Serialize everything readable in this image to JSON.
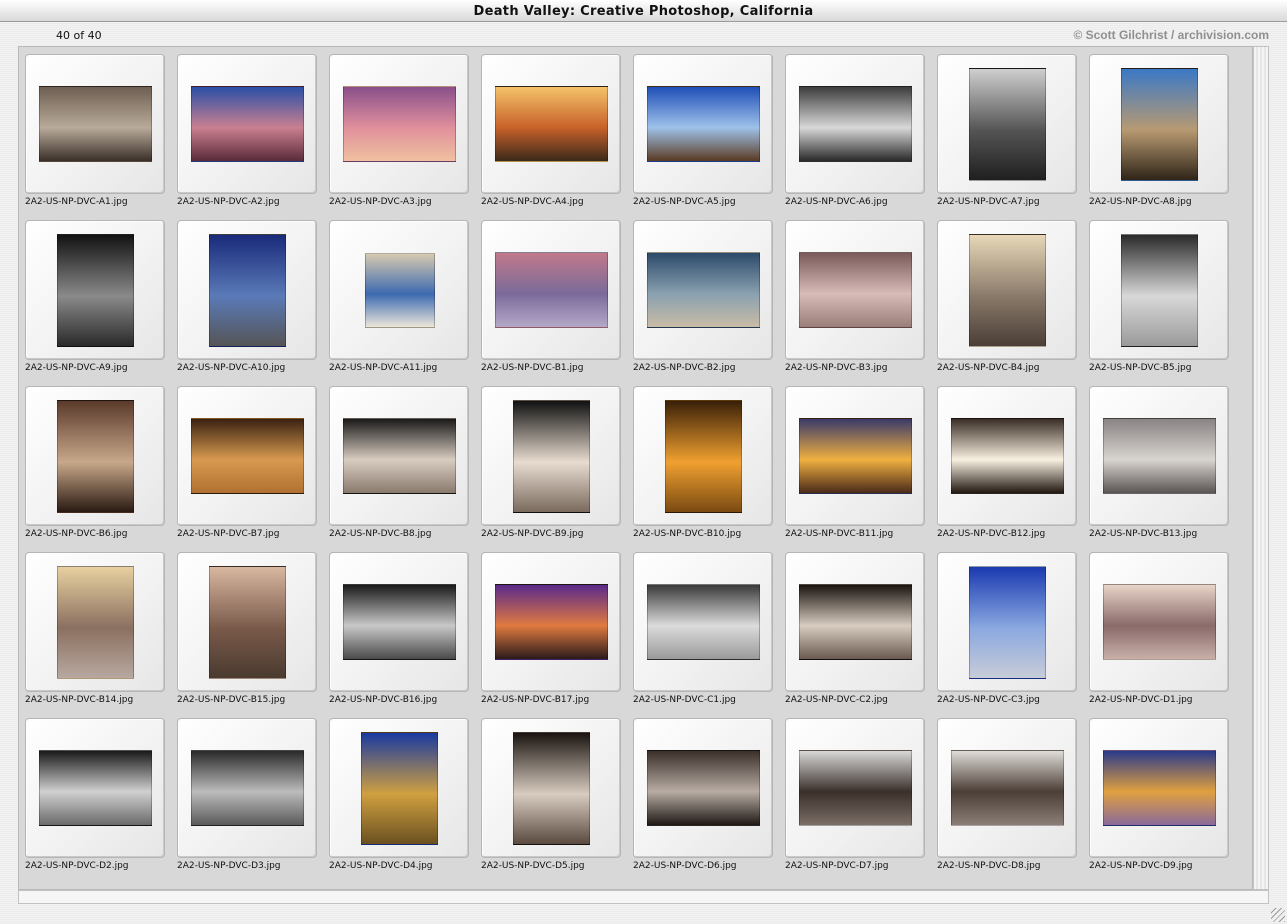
{
  "window": {
    "title": "Death Valley: Creative Photoshop, California"
  },
  "header": {
    "count": "40 of 40",
    "credit": "© Scott Gilchrist / archivision.com"
  },
  "thumbnails": [
    {
      "file": "2A2-US-NP-DVC-A1.jpg",
      "orientation": "landscape",
      "colors": [
        "#6e5f52",
        "#b8aa9a",
        "#3a3029"
      ]
    },
    {
      "file": "2A2-US-NP-DVC-A2.jpg",
      "orientation": "landscape",
      "colors": [
        "#2a4fa6",
        "#c98090",
        "#5a2a3a"
      ]
    },
    {
      "file": "2A2-US-NP-DVC-A3.jpg",
      "orientation": "landscape",
      "colors": [
        "#8a4f8a",
        "#e0909c",
        "#f0c0a0"
      ]
    },
    {
      "file": "2A2-US-NP-DVC-A4.jpg",
      "orientation": "landscape",
      "colors": [
        "#f4c26a",
        "#c8612a",
        "#3b2a1a"
      ]
    },
    {
      "file": "2A2-US-NP-DVC-A5.jpg",
      "orientation": "landscape",
      "colors": [
        "#1f4fb8",
        "#9fc2ea",
        "#5a3a22"
      ]
    },
    {
      "file": "2A2-US-NP-DVC-A6.jpg",
      "orientation": "landscape",
      "colors": [
        "#3d3d3d",
        "#d8d8d8",
        "#2a2a2a"
      ]
    },
    {
      "file": "2A2-US-NP-DVC-A7.jpg",
      "orientation": "portrait",
      "colors": [
        "#cfcfcf",
        "#555555",
        "#1f1f1f"
      ]
    },
    {
      "file": "2A2-US-NP-DVC-A8.jpg",
      "orientation": "portrait",
      "colors": [
        "#3b78c6",
        "#b89a72",
        "#2f2418"
      ]
    },
    {
      "file": "2A2-US-NP-DVC-A9.jpg",
      "orientation": "portrait",
      "colors": [
        "#121212",
        "#8a8a8a",
        "#2a2a2a"
      ]
    },
    {
      "file": "2A2-US-NP-DVC-A10.jpg",
      "orientation": "portrait",
      "colors": [
        "#1a2a7a",
        "#5a7ab8",
        "#555555"
      ]
    },
    {
      "file": "2A2-US-NP-DVC-A11.jpg",
      "orientation": "small",
      "colors": [
        "#d6c9b0",
        "#3c6ab0",
        "#ece6da"
      ]
    },
    {
      "file": "2A2-US-NP-DVC-B1.jpg",
      "orientation": "landscape",
      "colors": [
        "#c07a8a",
        "#7a6a9a",
        "#b4a8c8"
      ]
    },
    {
      "file": "2A2-US-NP-DVC-B2.jpg",
      "orientation": "landscape",
      "colors": [
        "#2c4a6a",
        "#8aa0b0",
        "#c8bca6"
      ]
    },
    {
      "file": "2A2-US-NP-DVC-B3.jpg",
      "orientation": "landscape",
      "colors": [
        "#7a5a5a",
        "#d8bcb8",
        "#9a7e7a"
      ]
    },
    {
      "file": "2A2-US-NP-DVC-B4.jpg",
      "orientation": "portrait",
      "colors": [
        "#e8d8b8",
        "#8a7a6a",
        "#4a3e36"
      ]
    },
    {
      "file": "2A2-US-NP-DVC-B5.jpg",
      "orientation": "portrait",
      "colors": [
        "#2a2a2a",
        "#d8d8d8",
        "#9a9a9a"
      ]
    },
    {
      "file": "2A2-US-NP-DVC-B6.jpg",
      "orientation": "portrait",
      "colors": [
        "#5a3a2a",
        "#c8a88a",
        "#2a1a12"
      ]
    },
    {
      "file": "2A2-US-NP-DVC-B7.jpg",
      "orientation": "landscape",
      "colors": [
        "#3a2212",
        "#d89a50",
        "#b07030"
      ]
    },
    {
      "file": "2A2-US-NP-DVC-B8.jpg",
      "orientation": "landscape",
      "colors": [
        "#1a1a1a",
        "#d8ccc0",
        "#8a7a6e"
      ]
    },
    {
      "file": "2A2-US-NP-DVC-B9.jpg",
      "orientation": "portrait",
      "colors": [
        "#111111",
        "#e8dcd0",
        "#7a6a5e"
      ]
    },
    {
      "file": "2A2-US-NP-DVC-B10.jpg",
      "orientation": "portrait",
      "colors": [
        "#3a2008",
        "#f0a030",
        "#7a4a12"
      ]
    },
    {
      "file": "2A2-US-NP-DVC-B11.jpg",
      "orientation": "landscape",
      "colors": [
        "#3a3a6a",
        "#f0b040",
        "#4a2a1a"
      ]
    },
    {
      "file": "2A2-US-NP-DVC-B12.jpg",
      "orientation": "landscape",
      "colors": [
        "#3a2e26",
        "#f8f0e0",
        "#201812"
      ]
    },
    {
      "file": "2A2-US-NP-DVC-B13.jpg",
      "orientation": "landscape",
      "colors": [
        "#8a8484",
        "#d8d4d0",
        "#5a5452"
      ]
    },
    {
      "file": "2A2-US-NP-DVC-B14.jpg",
      "orientation": "portrait",
      "colors": [
        "#e8d0a0",
        "#8a7060",
        "#b8a8a0"
      ]
    },
    {
      "file": "2A2-US-NP-DVC-B15.jpg",
      "orientation": "portrait",
      "colors": [
        "#d8b8a0",
        "#7a5a4a",
        "#4a3a30"
      ]
    },
    {
      "file": "2A2-US-NP-DVC-B16.jpg",
      "orientation": "landscape",
      "colors": [
        "#1a1a1a",
        "#c8c8c8",
        "#4a4a4a"
      ]
    },
    {
      "file": "2A2-US-NP-DVC-B17.jpg",
      "orientation": "landscape",
      "colors": [
        "#5a2a8a",
        "#e07a40",
        "#2a1a1a"
      ]
    },
    {
      "file": "2A2-US-NP-DVC-C1.jpg",
      "orientation": "landscape",
      "colors": [
        "#3a3a3a",
        "#dcdcdc",
        "#9a9a9a"
      ]
    },
    {
      "file": "2A2-US-NP-DVC-C2.jpg",
      "orientation": "landscape",
      "colors": [
        "#1a1410",
        "#d8ccc0",
        "#6a5a50"
      ]
    },
    {
      "file": "2A2-US-NP-DVC-C3.jpg",
      "orientation": "portrait",
      "colors": [
        "#1a3ab0",
        "#8aa8e0",
        "#c8ccd8"
      ]
    },
    {
      "file": "2A2-US-NP-DVC-D1.jpg",
      "orientation": "landscape",
      "colors": [
        "#e8d4c8",
        "#8a6a6a",
        "#c8b0a8"
      ]
    },
    {
      "file": "2A2-US-NP-DVC-D2.jpg",
      "orientation": "landscape",
      "colors": [
        "#1a1a1a",
        "#d0d0d0",
        "#6a6a6a"
      ]
    },
    {
      "file": "2A2-US-NP-DVC-D3.jpg",
      "orientation": "landscape",
      "colors": [
        "#2a2a2a",
        "#bcbcbc",
        "#5a5a5a"
      ]
    },
    {
      "file": "2A2-US-NP-DVC-D4.jpg",
      "orientation": "portrait",
      "colors": [
        "#1a3aa0",
        "#d0a040",
        "#6a5020"
      ]
    },
    {
      "file": "2A2-US-NP-DVC-D5.jpg",
      "orientation": "portrait",
      "colors": [
        "#1a1410",
        "#d8ccc0",
        "#5a4a40"
      ]
    },
    {
      "file": "2A2-US-NP-DVC-D6.jpg",
      "orientation": "landscape",
      "colors": [
        "#3a302a",
        "#b8aca4",
        "#1e1814"
      ]
    },
    {
      "file": "2A2-US-NP-DVC-D7.jpg",
      "orientation": "landscape",
      "colors": [
        "#d8d8d8",
        "#3a302a",
        "#7a6e66"
      ]
    },
    {
      "file": "2A2-US-NP-DVC-D8.jpg",
      "orientation": "landscape",
      "colors": [
        "#e0dcd8",
        "#4a3e36",
        "#8a7e76"
      ]
    },
    {
      "file": "2A2-US-NP-DVC-D9.jpg",
      "orientation": "landscape",
      "colors": [
        "#2a3a8a",
        "#e0a040",
        "#8a6a9a"
      ]
    }
  ]
}
